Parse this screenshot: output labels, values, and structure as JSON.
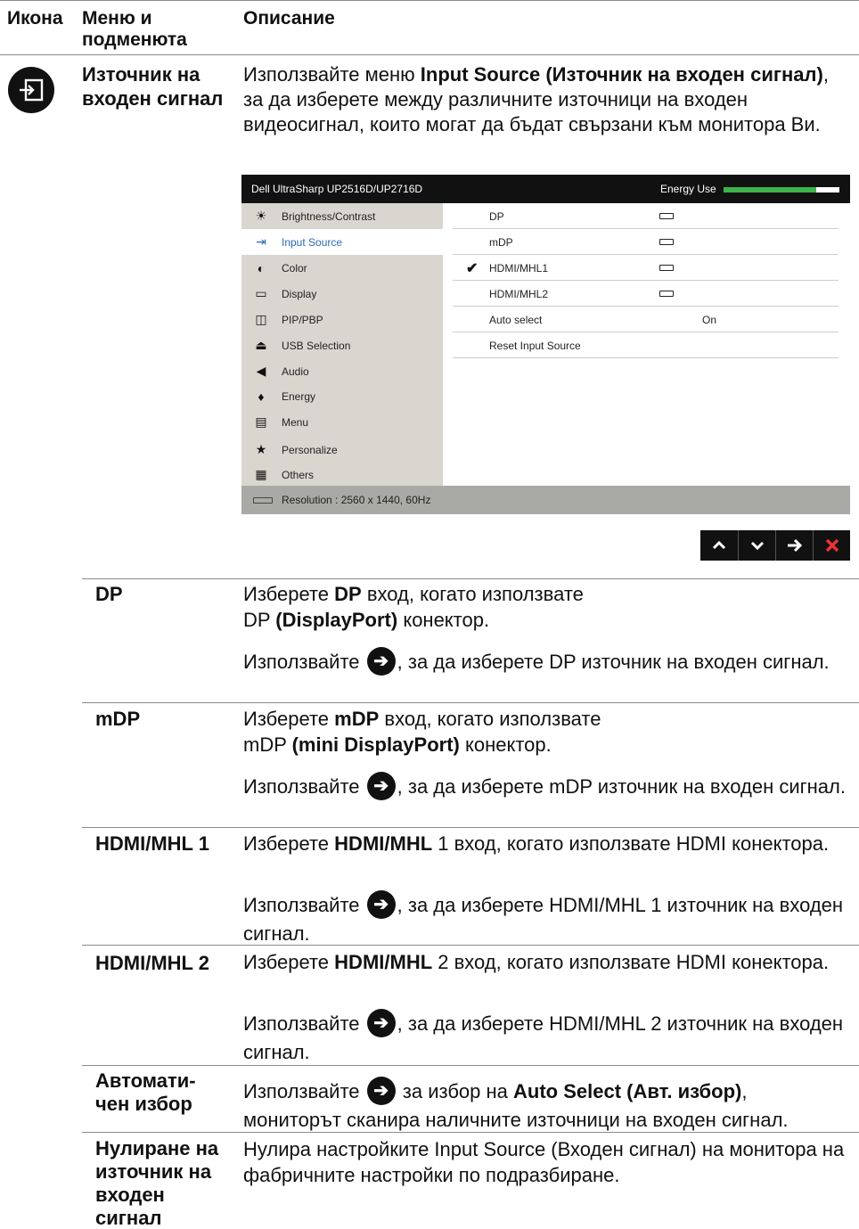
{
  "header": {
    "col_icon": "Икона",
    "col_menu": "Меню и подменюта",
    "col_desc": "Описание"
  },
  "main_item": {
    "title": "Източник на входен сигнал",
    "intro_pre": "Използвайте меню ",
    "intro_bold": "Input Source (Източник на входен сигнал)",
    "intro_post": ", за да изберете между различните източници на входен видеосигнал, които могат да бъдат свързани към монитора Ви."
  },
  "osd": {
    "title": "Dell UltraSharp UP2516D/UP2716D",
    "energy_label": "Energy Use",
    "energy_level": 0.8,
    "menu": [
      {
        "label": "Brightness/Contrast",
        "icon": "sun-icon"
      },
      {
        "label": "Input Source",
        "icon": "input-source-icon",
        "selected": true
      },
      {
        "label": "Color",
        "icon": "color-icon"
      },
      {
        "label": "Display",
        "icon": "display-icon"
      },
      {
        "label": "PIP/PBP",
        "icon": "pip-icon"
      },
      {
        "label": "USB Selection",
        "icon": "usb-icon"
      },
      {
        "label": "Audio",
        "icon": "speaker-icon"
      },
      {
        "label": "Energy",
        "icon": "flame-icon"
      },
      {
        "label": "Menu",
        "icon": "menu-icon"
      },
      {
        "label": "Personalize",
        "icon": "star-icon"
      },
      {
        "label": "Others",
        "icon": "others-icon"
      }
    ],
    "sources": [
      {
        "label": "DP"
      },
      {
        "label": "mDP"
      },
      {
        "label": "HDMI/MHL1",
        "checked": true
      },
      {
        "label": "HDMI/MHL2"
      },
      {
        "label": "Auto select",
        "value": "On"
      },
      {
        "label": "Reset Input Source"
      }
    ],
    "resolution": "Resolution : 2560 x 1440, 60Hz"
  },
  "options": [
    {
      "name": "DP",
      "l1_pre": "Изберете ",
      "l1_bold": "DP",
      "l1_mid": " вход, когато използвате",
      "l1b_pre": "DP ",
      "l1b_bold": "(DisplayPort)",
      "l1b_post": " конектор.",
      "l2_pre": "Използвайте ",
      "l2_post": ", за да изберете DP източник на входен сигнал."
    },
    {
      "name": "mDP",
      "l1_pre": "Изберете ",
      "l1_bold": "mDP",
      "l1_mid": " вход, когато използвате",
      "l1b_pre": "mDP ",
      "l1b_bold": "(mini DisplayPort)",
      "l1b_post": " конектор.",
      "l2_pre": "Използвайте ",
      "l2_post": ", за да изберете mDP източник на входен сигнал."
    },
    {
      "name": "HDMI/MHL 1",
      "l1_pre": "Изберете ",
      "l1_bold": "HDMI/MHL",
      "l1_mid": " 1 вход, когато използвате HDMI конектора.",
      "l2_pre": "Използвайте ",
      "l2_post": ", за да изберете HDMI/MHL 1 източник на входен сигнал."
    },
    {
      "name": "HDMI/MHL 2",
      "l1_pre": "Изберете ",
      "l1_bold": "HDMI/MHL",
      "l1_mid": " 2 вход, когато използвате HDMI конектора.",
      "l2_pre": "Използвайте ",
      "l2_post": ", за да изберете HDMI/MHL 2 източник на входен сигнал."
    },
    {
      "name": "Автомати-чен избор",
      "l2_pre": "Използвайте ",
      "l2_mid": " за избор на ",
      "l2_bold": "Auto Select (Авт. избор)",
      "l2_post": ", мониторът сканира наличните източници на входен сигнал."
    },
    {
      "name": "Нулиране на източник на входен сигнал",
      "l1_pre": "Нулира настройките Input Source (Входен сигнал) на монитора на фабричните настройки по подразбиране."
    }
  ]
}
